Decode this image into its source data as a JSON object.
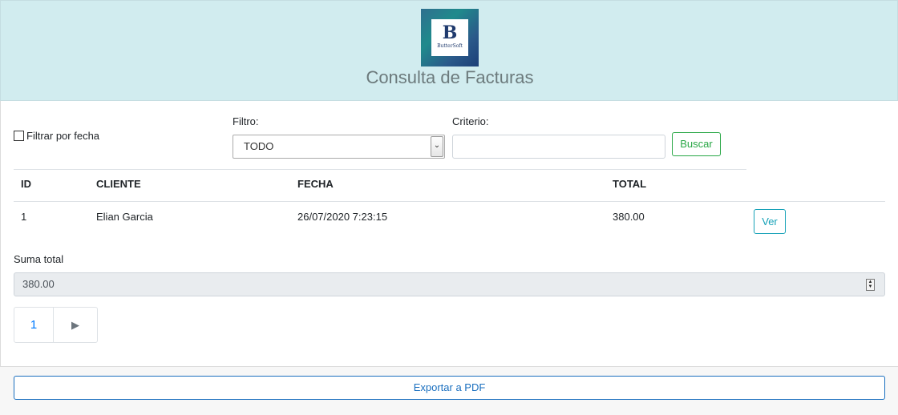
{
  "header": {
    "logo_letter": "B",
    "logo_text": "ButterSoft",
    "title": "Consulta de Facturas"
  },
  "filters": {
    "date_filter_label": "Filtrar por fecha",
    "date_filter_checked": false,
    "filter_label": "Filtro:",
    "filter_value": "TODO",
    "criteria_label": "Criterio:",
    "criteria_value": "",
    "search_button": "Buscar"
  },
  "table": {
    "columns": [
      "ID",
      "CLIENTE",
      "FECHA",
      "TOTAL"
    ],
    "rows": [
      {
        "id": "1",
        "cliente": "Elian Garcia",
        "fecha": "26/07/2020 7:23:15",
        "total": "380.00",
        "action": "Ver"
      }
    ]
  },
  "summary": {
    "label": "Suma total",
    "value": "380.00"
  },
  "pagination": {
    "current_page": "1",
    "next_symbol": "▶"
  },
  "footer": {
    "export_button": "Exportar a PDF"
  },
  "icons": {
    "select_arrow": "chevron-down-icon",
    "spinner": "number-spinner-icon",
    "next": "play-next-icon"
  },
  "colors": {
    "header_bg": "#d1ecef",
    "search_green": "#28a745",
    "view_teal": "#17a2b8",
    "pdf_blue": "#1a6fbf",
    "page_link": "#007bff"
  }
}
